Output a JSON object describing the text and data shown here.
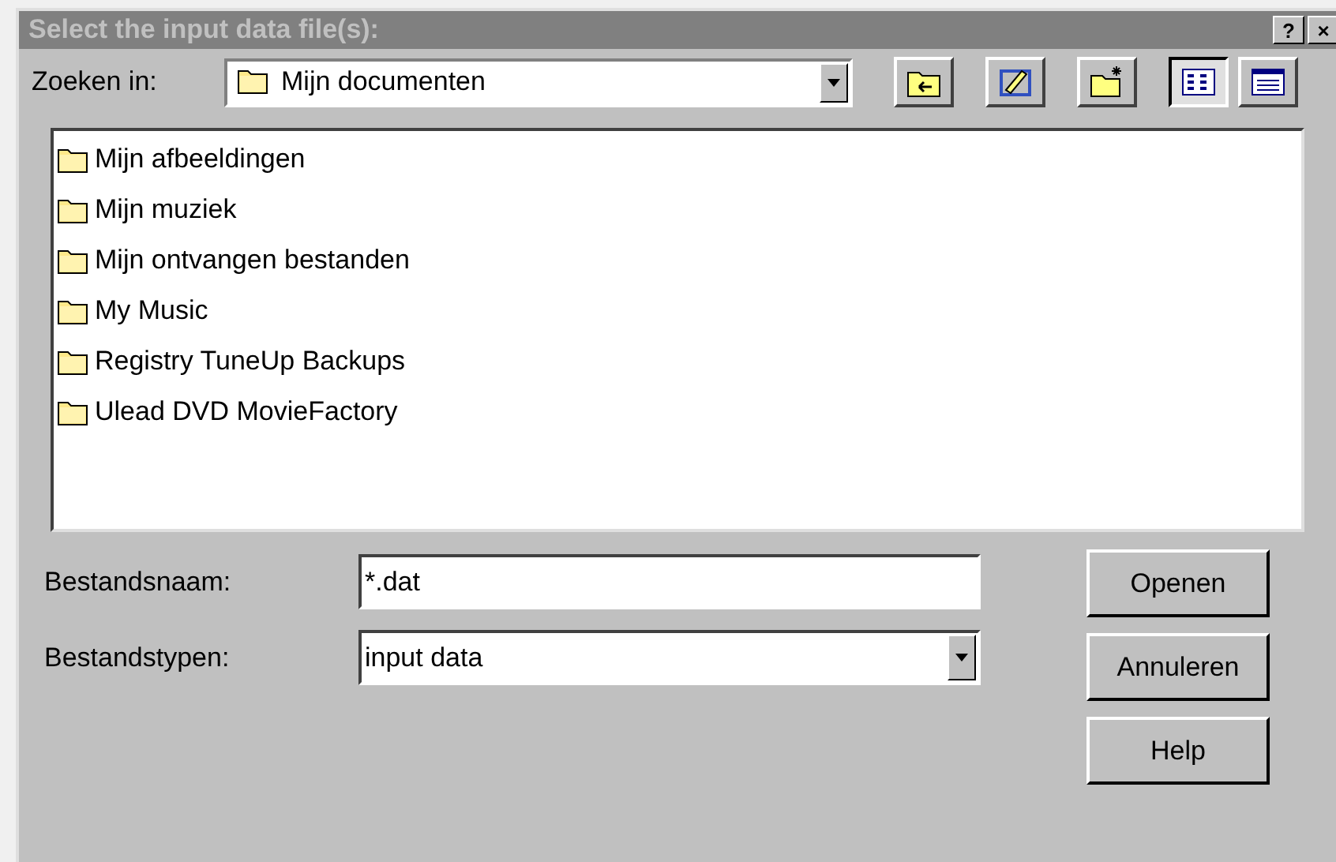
{
  "window": {
    "title": "Select the input data file(s):",
    "title_buttons": [
      "?",
      "×"
    ]
  },
  "look_in": {
    "label": "Zoeken in:",
    "value": "Mijn documenten"
  },
  "toolbar": [
    {
      "kind": "up"
    },
    {
      "kind": "edit"
    },
    {
      "kind": "new-folder"
    },
    {
      "kind": "list",
      "selected": true
    },
    {
      "kind": "details",
      "selected": false
    }
  ],
  "files": [
    {
      "name": "Mijn afbeeldingen"
    },
    {
      "name": "Mijn muziek"
    },
    {
      "name": "Mijn ontvangen bestanden"
    },
    {
      "name": "My Music"
    },
    {
      "name": "Registry TuneUp Backups"
    },
    {
      "name": "Ulead DVD MovieFactory"
    }
  ],
  "file_name": {
    "label": "Bestandsnaam:",
    "value": "*.dat"
  },
  "file_type": {
    "label": "Bestandstypen:",
    "value": "input data"
  },
  "buttons": [
    "Openen",
    "Annuleren",
    "Help"
  ]
}
